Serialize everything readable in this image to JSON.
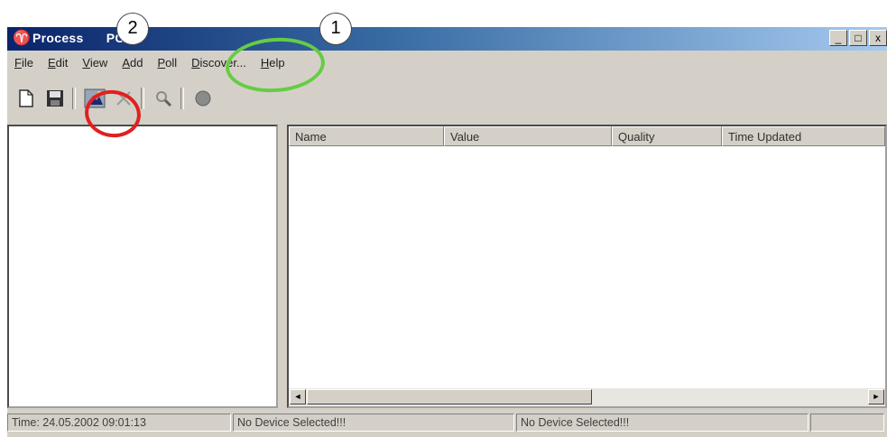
{
  "window": {
    "title": "Process      PCDA",
    "controls": [
      "_",
      "□",
      "x"
    ]
  },
  "menu": [
    "File",
    "Edit",
    "View",
    "Add",
    "Poll",
    "Discover...",
    "Help"
  ],
  "toolbar": {
    "buttons": [
      "new-icon",
      "save-icon",
      "discover-icon",
      "delete-icon",
      "search-icon",
      "record-icon"
    ]
  },
  "list": {
    "columns": [
      "Name",
      "Value",
      "Quality",
      "Time Updated"
    ]
  },
  "status": {
    "time": "Time: 24.05.2002 09:01:13",
    "device1": "No Device Selected!!!",
    "device2": "No Device Selected!!!"
  },
  "callouts": {
    "first": "1",
    "second": "2"
  },
  "colors": {
    "highlight_green": "#66cc44",
    "highlight_red": "#e02020",
    "title_gradient": "#0a246a"
  }
}
